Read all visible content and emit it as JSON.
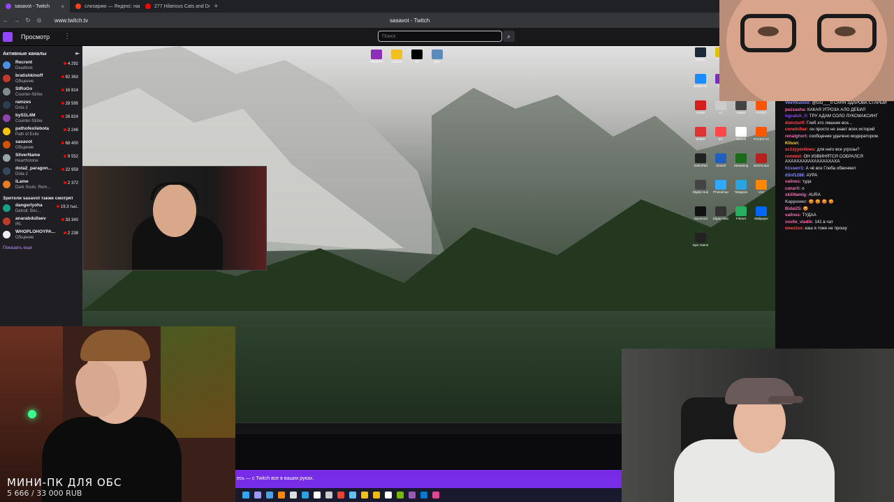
{
  "browser": {
    "tabs": [
      {
        "title": "sasavot - Twitch",
        "color": "#9147ff"
      },
      {
        "title": "слизарию — Яндекс: нашлось",
        "color": "#fc3f1d"
      },
      {
        "title": "277 Hilarious Cats and Dogs",
        "color": "#ff0000"
      }
    ],
    "new_tab": "+",
    "url": "www.twitch.tv",
    "window_title": "sasavot - Twitch"
  },
  "twitch": {
    "browse": "Просмотр",
    "search_placeholder": "Поиск",
    "sidebar": {
      "active_header": "Активные каналы",
      "collapse_icon": "arrow-collapse-icon",
      "channels": [
        {
          "name": "Recrent",
          "game": "Deadlock",
          "viewers": "4 292",
          "color": "#4a90e2"
        },
        {
          "name": "bratishkinoff",
          "game": "Общение",
          "viewers": "82 363",
          "color": "#c0392b"
        },
        {
          "name": "StRoGo",
          "game": "Counter-Strike",
          "viewers": "16 814",
          "color": "#7f8c8d"
        },
        {
          "name": "ramzes",
          "game": "Dota 2",
          "viewers": "28 595",
          "color": "#2c3e50"
        },
        {
          "name": "byS1L4M",
          "game": "Counter-Strike",
          "viewers": "26 824",
          "color": "#8e44ad"
        },
        {
          "name": "pathofexilebota",
          "game": "Path of Exile",
          "viewers": "2 246",
          "color": "#f1c40f"
        },
        {
          "name": "sasavot",
          "game": "Общение",
          "viewers": "68 400",
          "color": "#d35400"
        },
        {
          "name": "SilverName",
          "game": "Hearthstone",
          "viewers": "9 552",
          "color": "#95a5a6"
        },
        {
          "name": "dota2_paragon...",
          "game": "Dota 2",
          "viewers": "22 959",
          "color": "#34495e"
        },
        {
          "name": "iLame",
          "game": "Dark Souls: Rem...",
          "viewers": "2 372",
          "color": "#e67e22"
        }
      ],
      "viewers_also_header": "Зрители sasavot также смотрят",
      "also": [
        {
          "name": "dangerlyoha",
          "game": "Detroit: Bec...",
          "viewers": "19,3 тыс.",
          "color": "#16a085"
        },
        {
          "name": "anarabdullaev",
          "game": "IRL",
          "viewers": "33 340",
          "color": "#c0392b"
        },
        {
          "name": "WHOPLOHOYPA...",
          "game": "Общение",
          "viewers": "2 238",
          "color": "#ecf0f1"
        }
      ],
      "show_more": "Показать еще"
    }
  },
  "desktop": {
    "top_icons": [
      {
        "label": "WINRAR",
        "color": "#8e2fb8"
      },
      {
        "label": "GLBUS",
        "color": "#f0c020"
      },
      {
        "label": "93",
        "color": "#000000"
      },
      {
        "label": "фон",
        "color": "#5a8ac0"
      }
    ],
    "right_icons": [
      {
        "label": "Steam",
        "color": "#1b2838"
      },
      {
        "label": "",
        "color": "#e5c100"
      },
      {
        "label": "Rockstar",
        "color": "#f3b600"
      },
      {
        "label": "OBS",
        "color": "#222222"
      },
      {
        "label": "Battle.net",
        "color": "#1a8cff"
      },
      {
        "label": "MSI",
        "color": "#7b2fbf"
      },
      {
        "label": "Discord",
        "color": "#5865f2"
      },
      {
        "label": "Afterburner",
        "color": "#2ecc71"
      },
      {
        "label": "Adobe",
        "color": "#d61f1f"
      },
      {
        "label": "LC",
        "color": "#cccccc"
      },
      {
        "label": "Elgato",
        "color": "#444444"
      },
      {
        "label": "FACEIT",
        "color": "#ff5500"
      },
      {
        "label": "BitMSI",
        "color": "#dd3333"
      },
      {
        "label": "EA",
        "color": "#ff4747"
      },
      {
        "label": "Ubisoft",
        "color": "#ffffff"
      },
      {
        "label": "FACEIT AC",
        "color": "#ff5500"
      },
      {
        "label": "VideoPad",
        "color": "#222222"
      },
      {
        "label": "Ubisoft",
        "color": "#1f5fbf"
      },
      {
        "label": "Streaming",
        "color": "#1b6b1b"
      },
      {
        "label": "DZSALauncher",
        "color": "#b82020"
      },
      {
        "label": "Elgato Hub",
        "color": "#444444"
      },
      {
        "label": "Photoshop",
        "color": "#31a8ff"
      },
      {
        "label": "Telegram",
        "color": "#2aa3e0"
      },
      {
        "label": "VLC",
        "color": "#ff8800"
      },
      {
        "label": "Voicemod",
        "color": "#111111"
      },
      {
        "label": "Elgato Wave",
        "color": "#333333"
      },
      {
        "label": "FileSet",
        "color": "#27ae60"
      },
      {
        "label": "Wallpaper",
        "color": "#0066ff"
      },
      {
        "label": "Epic Games",
        "color": "#222222"
      }
    ]
  },
  "chat": [
    {
      "user": "VeeVkusnoi:",
      "color": "#8a8aff",
      "text": "@GG___0 САНЯ ЗДАРОВА СТАРЫЙ"
    },
    {
      "user": "puzsasha:",
      "color": "#ff69b4",
      "text": "КАКАЯ УГРОЗА АЛО ДЕБИЛ"
    },
    {
      "user": "lrgcatch_0:",
      "color": "#9147ff",
      "text": "ТРУ АДАМ СОЛО ЛУКСМАКСИНГ"
    },
    {
      "user": "dstrcturlf:",
      "color": "#ff4f4f",
      "text": "Глеб это лишнее все..."
    },
    {
      "user": "conelnihar:",
      "color": "#ff4f4f",
      "text": "он просто не знает всех историй"
    },
    {
      "user": "renalghort:",
      "color": "#ff69b4",
      "text": "сообщение удалено модератором."
    },
    {
      "user": "Klissn:",
      "color": "#ffd700",
      "text": ""
    },
    {
      "user": "sc1zyyonlines:",
      "color": "#ff4f4f",
      "text": "для него все угрозы?"
    },
    {
      "user": "rommst:",
      "color": "#ff4f4f",
      "text": "ОН ИЗВИНЯТСЯ СОБРАЛСЯ АХАХАХАХАХАХАХАХАХА"
    },
    {
      "user": "h1sserr1:",
      "color": "#8a8aff",
      "text": "А чё все Глеба обвиняют"
    },
    {
      "user": "d3nf1288:",
      "color": "#8a8aff",
      "text": "АУРА"
    },
    {
      "user": "vailnes:",
      "color": "#ff69b4",
      "text": "туда"
    },
    {
      "user": "canarit:",
      "color": "#ff69b4",
      "text": "о"
    },
    {
      "user": "skill4amig:",
      "color": "#ff69b4",
      "text": "AURA"
    },
    {
      "user": "Kappower:",
      "color": "#adadb8",
      "text": "😡 😡 😡 😡"
    },
    {
      "user": "Bidai25:",
      "color": "#ff69b4",
      "text": "😡"
    },
    {
      "user": "vailnes:",
      "color": "#ff69b4",
      "text": "ТУДАА"
    },
    {
      "user": "zovite_vladik:",
      "color": "#ff69b4",
      "text": "141 в чат"
    },
    {
      "user": "weezzss:",
      "color": "#ff4f4f",
      "text": "каш я тоже не прошу"
    }
  ],
  "overlay": {
    "title": "МИНИ-ПК  ДЛЯ  ОБС",
    "price": "5 666 / 33 000 RUB"
  },
  "promo": "есь — с Twitch все в ваших руках.",
  "taskbar": [
    {
      "icon": "photoshop-icon",
      "color": "#31a8ff"
    },
    {
      "icon": "after-effects-icon",
      "color": "#9999ff"
    },
    {
      "icon": "explorer-icon",
      "color": "#4aa3df"
    },
    {
      "icon": "vlc-icon",
      "color": "#ff8800"
    },
    {
      "icon": "file-icon",
      "color": "#dddddd"
    },
    {
      "icon": "telegram-icon",
      "color": "#2aa3e0"
    },
    {
      "icon": "obs-icon",
      "color": "#ffffff"
    },
    {
      "icon": "obs-alt-icon",
      "color": "#cccccc"
    },
    {
      "icon": "chrome-icon",
      "color": "#ea4335"
    },
    {
      "icon": "steam-icon",
      "color": "#66c0f4"
    },
    {
      "icon": "folder-icon",
      "color": "#f0c020"
    },
    {
      "icon": "binance-icon",
      "color": "#f0b90b"
    },
    {
      "icon": "epic-icon",
      "color": "#ffffff"
    },
    {
      "icon": "nvidia-icon",
      "color": "#76b900"
    },
    {
      "icon": "app-icon",
      "color": "#9b59b6"
    },
    {
      "icon": "edge-icon",
      "color": "#0078d4"
    },
    {
      "icon": "app2-icon",
      "color": "#e84393"
    }
  ]
}
